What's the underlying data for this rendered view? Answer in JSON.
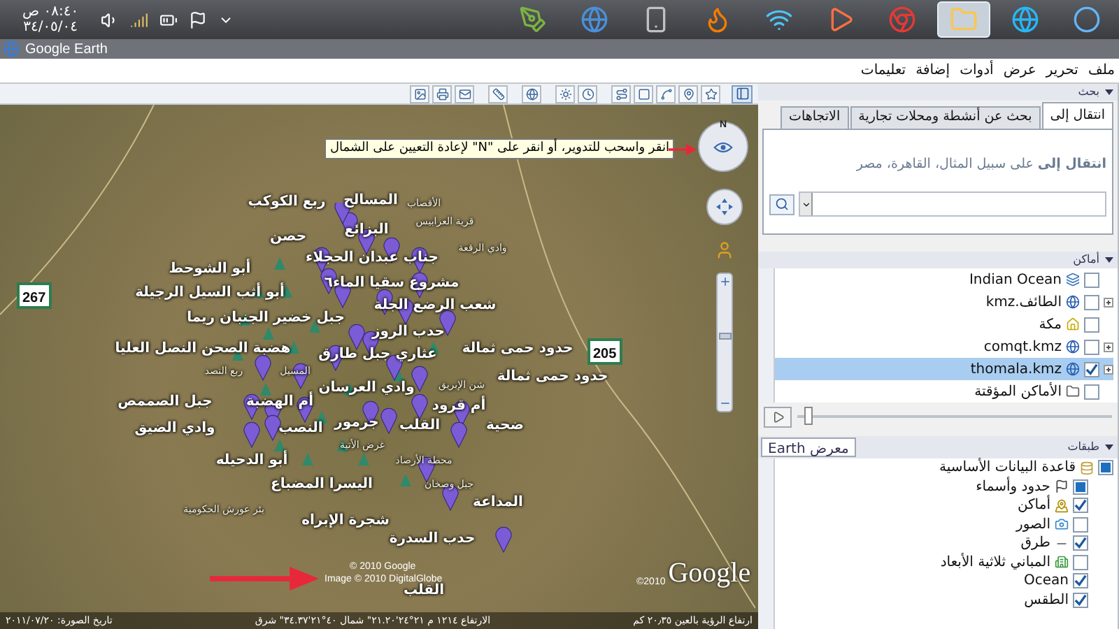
{
  "taskbar": {
    "clock_time": "٠٨:٤٠ ص",
    "clock_date": "٣٤/٠٥/٠٤",
    "apps": [
      {
        "kind": "pen",
        "selected": false
      },
      {
        "kind": "earth",
        "selected": false
      },
      {
        "kind": "phone",
        "selected": false
      },
      {
        "kind": "browser",
        "selected": false
      },
      {
        "kind": "network",
        "selected": false
      },
      {
        "kind": "media",
        "selected": false
      },
      {
        "kind": "chrome",
        "selected": false
      },
      {
        "kind": "folder",
        "selected": true
      },
      {
        "kind": "ie",
        "selected": false
      },
      {
        "kind": "start",
        "selected": false
      }
    ]
  },
  "window": {
    "title": "Google Earth"
  },
  "menu": [
    "ملف",
    "تحرير",
    "عرض",
    "أدوات",
    "إضافة",
    "تعليمات"
  ],
  "map": {
    "tooltip": "انقر واسحب للتدوير، أو انقر على \"N\" لإعادة التعيين على الشمال",
    "compass_letter": "N",
    "zoom": {
      "level": 0.55
    },
    "road_shields": [
      "267",
      "205"
    ],
    "labels": [
      {
        "text": "الأقصاب",
        "kind": "minor"
      },
      {
        "text": "المسالح",
        "kind": "major"
      },
      {
        "text": "ربع الكوكب",
        "kind": "major"
      },
      {
        "text": "قرية العرابيس",
        "kind": "minor"
      },
      {
        "text": "البزائع",
        "kind": "major"
      },
      {
        "text": "حصن",
        "kind": "major"
      },
      {
        "text": "وادي الرقعة",
        "kind": "minor"
      },
      {
        "text": "جناب عبدان الحجلاء",
        "kind": "major"
      },
      {
        "text": "أبو الشوحط",
        "kind": "major"
      },
      {
        "text": "مشروع سقيا الماء٦",
        "kind": "major"
      },
      {
        "text": "أبو أثب السيل الرجيلة",
        "kind": "major"
      },
      {
        "text": "شعب الرضع الجلة",
        "kind": "major"
      },
      {
        "text": "جبل خضير الجنبان ريما",
        "kind": "major"
      },
      {
        "text": "حدب الروز",
        "kind": "major"
      },
      {
        "text": "حدود حمى ثمالة",
        "kind": "major"
      },
      {
        "text": "عثاري جبل طارق",
        "kind": "major"
      },
      {
        "text": "هضبة الصحن النصل العليا",
        "kind": "major"
      },
      {
        "text": "حدود حمى ثمالة",
        "kind": "major"
      },
      {
        "text": "المسيل",
        "kind": "minor"
      },
      {
        "text": "ربع النصد",
        "kind": "minor"
      },
      {
        "text": "شن الإبريق",
        "kind": "minor"
      },
      {
        "text": "وادي العرسان",
        "kind": "major"
      },
      {
        "text": "أم قرود",
        "kind": "major"
      },
      {
        "text": "أم الهضبة",
        "kind": "major"
      },
      {
        "text": "جبل الصممص",
        "kind": "major"
      },
      {
        "text": "ضحية",
        "kind": "major"
      },
      {
        "text": "القلب",
        "kind": "major"
      },
      {
        "text": "جرمور",
        "kind": "major"
      },
      {
        "text": "النصب",
        "kind": "major"
      },
      {
        "text": "وادي الضيق",
        "kind": "major"
      },
      {
        "text": "غرض الأتية",
        "kind": "minor"
      },
      {
        "text": "محطة الأرصاد",
        "kind": "minor"
      },
      {
        "text": "أبو الدحيله",
        "kind": "major"
      },
      {
        "text": "جبل وصخان",
        "kind": "minor"
      },
      {
        "text": "اليسرا المضباع",
        "kind": "major"
      },
      {
        "text": "المداعة",
        "kind": "major"
      },
      {
        "text": "بئر عورش الحكومية",
        "kind": "minor"
      },
      {
        "text": "شجرة الإبراه",
        "kind": "major"
      },
      {
        "text": "حدب السدرة",
        "kind": "major"
      },
      {
        "text": "القلب",
        "kind": "major"
      }
    ],
    "copyright": [
      "© 2010 Google",
      "Image © 2010 DigitalGlobe"
    ],
    "logo_year": "©2010",
    "logo": "Google",
    "status_bar": {
      "image_date": "تاريخ الصورة: ٢٠١١/٠٧/٢٠",
      "position": "الارتفاع ١٢١٤ م  ٢١°٢٤'٢١.٢٠\" شمال  ٤٠°٢١'٣٤.٣٧\" شرق",
      "eye_altitude": "ارتفاع الرؤية بالعين ٢٠٫٣٥ كم"
    }
  },
  "search": {
    "header": "بحث",
    "tabs": [
      {
        "label": "انتقال إلى",
        "selected": true
      },
      {
        "label": "بحث عن أنشطة ومحلات تجارية",
        "selected": false
      },
      {
        "label": "الاتجاهات",
        "selected": false
      }
    ],
    "hint": "**انتقال إلى** على سبيل المثال، القاهرة، مصر"
  },
  "places": {
    "header": "أماكن",
    "items": [
      {
        "label": "Indian Ocean",
        "kind": "overlay",
        "checked": false,
        "selected": false,
        "expandable": false
      },
      {
        "label": "الطائف.kmz",
        "kind": "kmz",
        "checked": false,
        "selected": false,
        "expandable": true
      },
      {
        "label": "مكة",
        "kind": "placemark",
        "checked": false,
        "selected": false,
        "expandable": false
      },
      {
        "label": "comqt.kmz",
        "kind": "kmz",
        "checked": false,
        "selected": false,
        "expandable": true
      },
      {
        "label": "thomala.kmz",
        "kind": "kmz",
        "checked": true,
        "selected": true,
        "expandable": true
      },
      {
        "label": "الأماكن المؤقتة",
        "kind": "folder",
        "checked": false,
        "selected": false,
        "expandable": false
      }
    ],
    "tour_slider": {
      "level": 0.02
    }
  },
  "layers": {
    "header": "طبقات",
    "gallery": "معرض Earth",
    "items": [
      {
        "label": "قاعدة البيانات الأساسية",
        "kind": "database",
        "checked": true,
        "mixed": true,
        "children": [
          {
            "label": "حدود وأسماء",
            "kind": "borders",
            "checked": true,
            "mixed": true
          },
          {
            "label": "أماكن",
            "kind": "places",
            "checked": true,
            "mixed": false
          },
          {
            "label": "الصور",
            "kind": "photos",
            "checked": false,
            "mixed": false
          },
          {
            "label": "طرق",
            "kind": "roads",
            "checked": true,
            "mixed": false
          },
          {
            "label": "المباني ثلاثية الأبعاد",
            "kind": "buildings",
            "checked": false,
            "mixed": false
          },
          {
            "label": "Ocean",
            "kind": "plain",
            "checked": true,
            "mixed": false
          },
          {
            "label": "الطقس",
            "kind": "plain",
            "checked": true,
            "mixed": false
          }
        ]
      }
    ]
  }
}
